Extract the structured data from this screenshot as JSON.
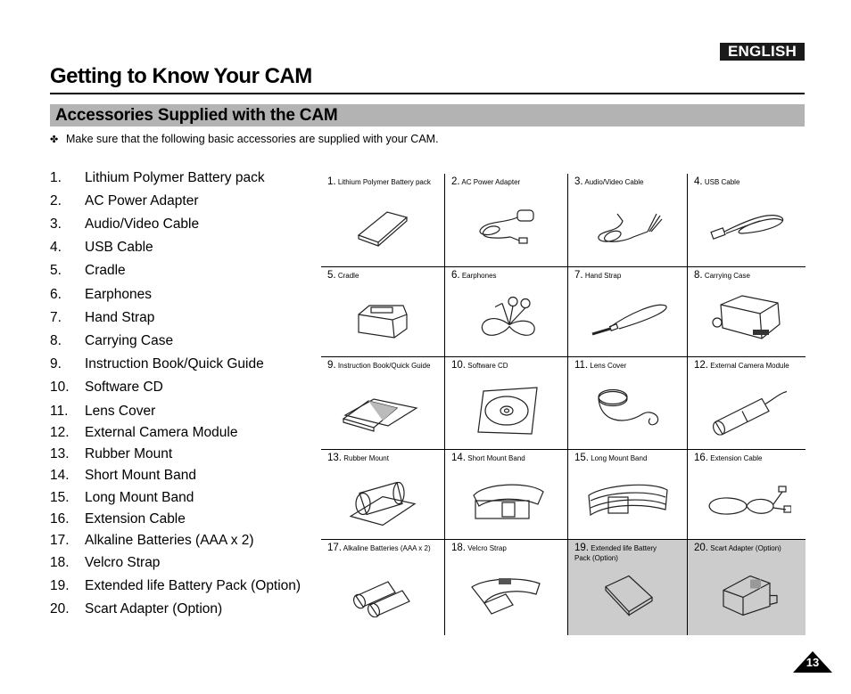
{
  "header": {
    "language_badge": "ENGLISH",
    "page_title": "Getting to Know Your CAM",
    "section_title": "Accessories Supplied with the CAM",
    "note_bullet": "✤",
    "note": "Make sure that the following basic accessories are supplied with your CAM."
  },
  "accessories": [
    {
      "num": "1.",
      "label": "Lithium Polymer Battery pack"
    },
    {
      "num": "2.",
      "label": "AC Power Adapter"
    },
    {
      "num": "3.",
      "label": "Audio/Video Cable"
    },
    {
      "num": "4.",
      "label": "USB Cable"
    },
    {
      "num": "5.",
      "label": "Cradle"
    },
    {
      "num": "6.",
      "label": "Earphones"
    },
    {
      "num": "7.",
      "label": "Hand Strap"
    },
    {
      "num": "8.",
      "label": "Carrying Case"
    },
    {
      "num": "9.",
      "label": "Instruction Book/Quick Guide"
    },
    {
      "num": "10.",
      "label": "Software CD"
    },
    {
      "num": "11.",
      "label": "Lens Cover"
    },
    {
      "num": "12.",
      "label": "External Camera Module"
    },
    {
      "num": "13.",
      "label": "Rubber Mount"
    },
    {
      "num": "14.",
      "label": "Short Mount Band"
    },
    {
      "num": "15.",
      "label": "Long Mount Band"
    },
    {
      "num": "16.",
      "label": "Extension Cable"
    },
    {
      "num": "17.",
      "label": "Alkaline Batteries (AAA x 2)"
    },
    {
      "num": "18.",
      "label": "Velcro Strap"
    },
    {
      "num": "19.",
      "label": "Extended life Battery Pack (Option)"
    },
    {
      "num": "20.",
      "label": "Scart Adapter (Option)"
    }
  ],
  "grid": [
    {
      "num": "1.",
      "caption": "Lithium Polymer Battery pack",
      "icon": "battery-pack-icon",
      "optional": false
    },
    {
      "num": "2.",
      "caption": "AC Power Adapter",
      "icon": "power-adapter-icon",
      "optional": false
    },
    {
      "num": "3.",
      "caption": "Audio/Video Cable",
      "icon": "av-cable-icon",
      "optional": false
    },
    {
      "num": "4.",
      "caption": "USB Cable",
      "icon": "usb-cable-icon",
      "optional": false
    },
    {
      "num": "5.",
      "caption": "Cradle",
      "icon": "cradle-icon",
      "optional": false
    },
    {
      "num": "6.",
      "caption": "Earphones",
      "icon": "earphones-icon",
      "optional": false
    },
    {
      "num": "7.",
      "caption": "Hand Strap",
      "icon": "hand-strap-icon",
      "optional": false
    },
    {
      "num": "8.",
      "caption": "Carrying Case",
      "icon": "carrying-case-icon",
      "optional": false
    },
    {
      "num": "9.",
      "caption": "Instruction Book/Quick Guide",
      "icon": "instruction-book-icon",
      "optional": false
    },
    {
      "num": "10.",
      "caption": "Software CD",
      "icon": "software-cd-icon",
      "optional": false
    },
    {
      "num": "11.",
      "caption": "Lens Cover",
      "icon": "lens-cover-icon",
      "optional": false
    },
    {
      "num": "12.",
      "caption": "External Camera Module",
      "icon": "camera-module-icon",
      "optional": false
    },
    {
      "num": "13.",
      "caption": "Rubber Mount",
      "icon": "rubber-mount-icon",
      "optional": false
    },
    {
      "num": "14.",
      "caption": "Short Mount Band",
      "icon": "short-band-icon",
      "optional": false
    },
    {
      "num": "15.",
      "caption": "Long Mount Band",
      "icon": "long-band-icon",
      "optional": false
    },
    {
      "num": "16.",
      "caption": "Extension Cable",
      "icon": "extension-cable-icon",
      "optional": false
    },
    {
      "num": "17.",
      "caption": "Alkaline Batteries (AAA x 2)",
      "icon": "aaa-batteries-icon",
      "optional": false
    },
    {
      "num": "18.",
      "caption": "Velcro Strap",
      "icon": "velcro-strap-icon",
      "optional": false
    },
    {
      "num": "19.",
      "caption": "Extended life Battery Pack (Option)",
      "icon": "extended-battery-icon",
      "optional": true
    },
    {
      "num": "20.",
      "caption": "Scart Adapter (Option)",
      "icon": "scart-adapter-icon",
      "optional": true
    }
  ],
  "footer": {
    "page_number": "13"
  }
}
